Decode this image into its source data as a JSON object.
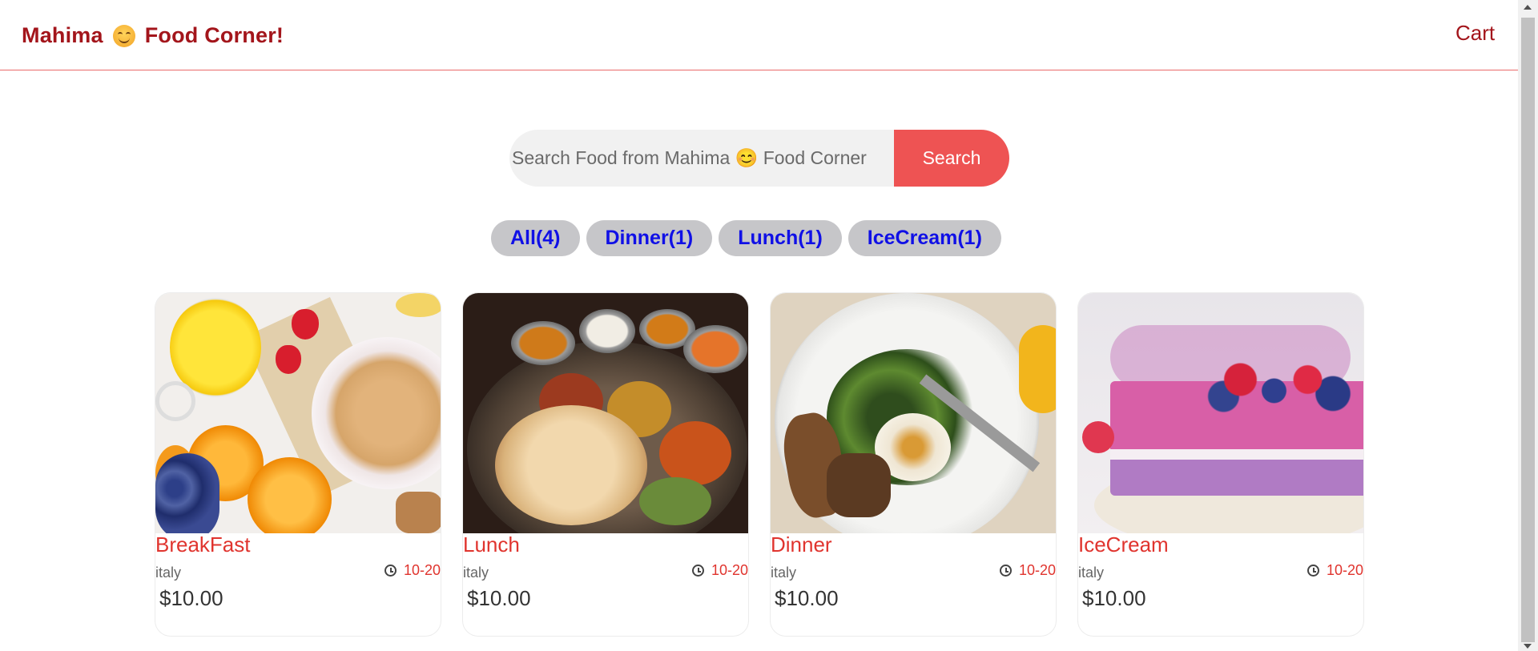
{
  "header": {
    "brand_part1": "Mahima",
    "brand_part2": "Food Corner!",
    "brand_icon": "smiling-face-emoji",
    "cart_label": "Cart"
  },
  "search": {
    "placeholder": "Search Food from Mahima 😊 Food Corner",
    "button_label": "Search"
  },
  "tags": [
    {
      "label": "All(4)"
    },
    {
      "label": "Dinner(1)"
    },
    {
      "label": "Lunch(1)"
    },
    {
      "label": "IceCream(1)"
    }
  ],
  "foods": [
    {
      "name": "BreakFast",
      "origin": "italy",
      "time": "10-20",
      "price": "$10.00"
    },
    {
      "name": "Lunch",
      "origin": "italy",
      "time": "10-20",
      "price": "$10.00"
    },
    {
      "name": "Dinner",
      "origin": "italy",
      "time": "10-20",
      "price": "$10.00"
    },
    {
      "name": "IceCream",
      "origin": "italy",
      "time": "10-20",
      "price": "$10.00"
    }
  ],
  "colors": {
    "brand": "#a3151b",
    "accent": "#ee5353",
    "tag_text": "#1010e6",
    "tag_bg": "#c6c6c9",
    "food_name": "#e0342e"
  }
}
